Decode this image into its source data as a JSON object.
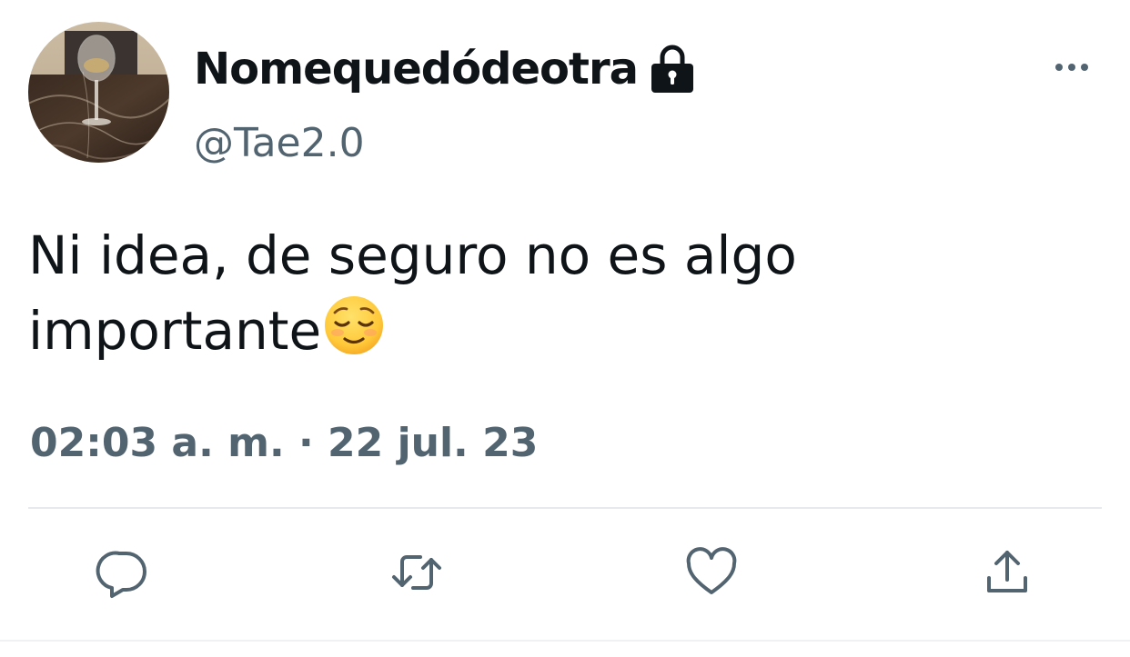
{
  "author": {
    "display_name": "Nomequedódeotra",
    "handle": "@Tae2.0",
    "protected_icon": "lock-icon",
    "avatar": "wine-glass-photo"
  },
  "menu": {
    "icon": "more-horizontal-icon"
  },
  "tweet": {
    "lines": [
      "Ni idea, de seguro no es algo",
      "importante"
    ],
    "emoji": "relieved-face-emoji"
  },
  "meta": {
    "timestamp": "02:03 a. m. · 22 jul. 23"
  },
  "actions": [
    {
      "name": "reply",
      "icon": "speech-bubble-icon"
    },
    {
      "name": "retweet",
      "icon": "retweet-icon"
    },
    {
      "name": "like",
      "icon": "heart-icon"
    },
    {
      "name": "share",
      "icon": "share-upload-icon"
    }
  ],
  "colors": {
    "text_primary": "#0f1419",
    "text_secondary": "#536471",
    "divider": "#e7e9ec"
  }
}
